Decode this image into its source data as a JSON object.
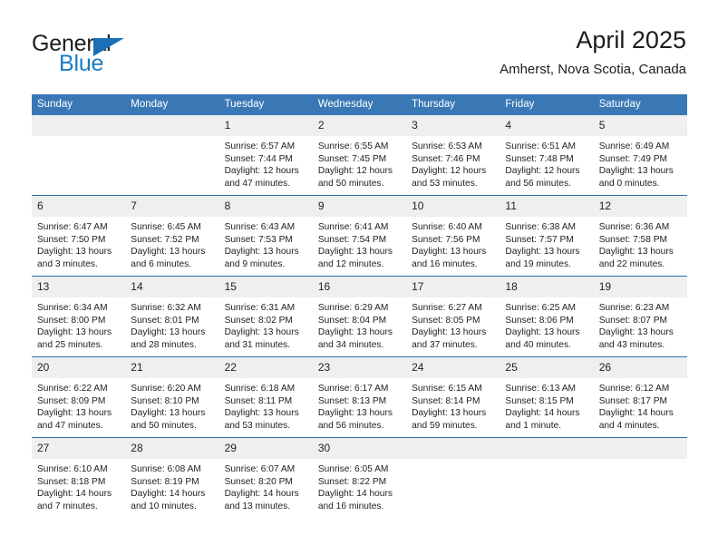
{
  "brand": {
    "name_part1": "General",
    "name_part2": "Blue",
    "triangle_color": "#1a6fb5",
    "blue_text_color": "#1a7bc4"
  },
  "header": {
    "title": "April 2025",
    "subtitle": "Amherst, Nova Scotia, Canada"
  },
  "theme": {
    "header_blue": "#3a78b5",
    "grid_line_blue": "#2e6da4",
    "daynum_band": "#efefef",
    "text": "#222222"
  },
  "calendar": {
    "weekday_headers": [
      "Sunday",
      "Monday",
      "Tuesday",
      "Wednesday",
      "Thursday",
      "Friday",
      "Saturday"
    ],
    "weeks": [
      [
        {
          "day": "",
          "sunrise": "",
          "sunset": "",
          "daylight_line1": "",
          "daylight_line2": "",
          "blank": true
        },
        {
          "day": "",
          "sunrise": "",
          "sunset": "",
          "daylight_line1": "",
          "daylight_line2": "",
          "blank": true
        },
        {
          "day": "1",
          "sunrise": "Sunrise: 6:57 AM",
          "sunset": "Sunset: 7:44 PM",
          "daylight_line1": "Daylight: 12 hours",
          "daylight_line2": "and 47 minutes."
        },
        {
          "day": "2",
          "sunrise": "Sunrise: 6:55 AM",
          "sunset": "Sunset: 7:45 PM",
          "daylight_line1": "Daylight: 12 hours",
          "daylight_line2": "and 50 minutes."
        },
        {
          "day": "3",
          "sunrise": "Sunrise: 6:53 AM",
          "sunset": "Sunset: 7:46 PM",
          "daylight_line1": "Daylight: 12 hours",
          "daylight_line2": "and 53 minutes."
        },
        {
          "day": "4",
          "sunrise": "Sunrise: 6:51 AM",
          "sunset": "Sunset: 7:48 PM",
          "daylight_line1": "Daylight: 12 hours",
          "daylight_line2": "and 56 minutes."
        },
        {
          "day": "5",
          "sunrise": "Sunrise: 6:49 AM",
          "sunset": "Sunset: 7:49 PM",
          "daylight_line1": "Daylight: 13 hours",
          "daylight_line2": "and 0 minutes."
        }
      ],
      [
        {
          "day": "6",
          "sunrise": "Sunrise: 6:47 AM",
          "sunset": "Sunset: 7:50 PM",
          "daylight_line1": "Daylight: 13 hours",
          "daylight_line2": "and 3 minutes."
        },
        {
          "day": "7",
          "sunrise": "Sunrise: 6:45 AM",
          "sunset": "Sunset: 7:52 PM",
          "daylight_line1": "Daylight: 13 hours",
          "daylight_line2": "and 6 minutes."
        },
        {
          "day": "8",
          "sunrise": "Sunrise: 6:43 AM",
          "sunset": "Sunset: 7:53 PM",
          "daylight_line1": "Daylight: 13 hours",
          "daylight_line2": "and 9 minutes."
        },
        {
          "day": "9",
          "sunrise": "Sunrise: 6:41 AM",
          "sunset": "Sunset: 7:54 PM",
          "daylight_line1": "Daylight: 13 hours",
          "daylight_line2": "and 12 minutes."
        },
        {
          "day": "10",
          "sunrise": "Sunrise: 6:40 AM",
          "sunset": "Sunset: 7:56 PM",
          "daylight_line1": "Daylight: 13 hours",
          "daylight_line2": "and 16 minutes."
        },
        {
          "day": "11",
          "sunrise": "Sunrise: 6:38 AM",
          "sunset": "Sunset: 7:57 PM",
          "daylight_line1": "Daylight: 13 hours",
          "daylight_line2": "and 19 minutes."
        },
        {
          "day": "12",
          "sunrise": "Sunrise: 6:36 AM",
          "sunset": "Sunset: 7:58 PM",
          "daylight_line1": "Daylight: 13 hours",
          "daylight_line2": "and 22 minutes."
        }
      ],
      [
        {
          "day": "13",
          "sunrise": "Sunrise: 6:34 AM",
          "sunset": "Sunset: 8:00 PM",
          "daylight_line1": "Daylight: 13 hours",
          "daylight_line2": "and 25 minutes."
        },
        {
          "day": "14",
          "sunrise": "Sunrise: 6:32 AM",
          "sunset": "Sunset: 8:01 PM",
          "daylight_line1": "Daylight: 13 hours",
          "daylight_line2": "and 28 minutes."
        },
        {
          "day": "15",
          "sunrise": "Sunrise: 6:31 AM",
          "sunset": "Sunset: 8:02 PM",
          "daylight_line1": "Daylight: 13 hours",
          "daylight_line2": "and 31 minutes."
        },
        {
          "day": "16",
          "sunrise": "Sunrise: 6:29 AM",
          "sunset": "Sunset: 8:04 PM",
          "daylight_line1": "Daylight: 13 hours",
          "daylight_line2": "and 34 minutes."
        },
        {
          "day": "17",
          "sunrise": "Sunrise: 6:27 AM",
          "sunset": "Sunset: 8:05 PM",
          "daylight_line1": "Daylight: 13 hours",
          "daylight_line2": "and 37 minutes."
        },
        {
          "day": "18",
          "sunrise": "Sunrise: 6:25 AM",
          "sunset": "Sunset: 8:06 PM",
          "daylight_line1": "Daylight: 13 hours",
          "daylight_line2": "and 40 minutes."
        },
        {
          "day": "19",
          "sunrise": "Sunrise: 6:23 AM",
          "sunset": "Sunset: 8:07 PM",
          "daylight_line1": "Daylight: 13 hours",
          "daylight_line2": "and 43 minutes."
        }
      ],
      [
        {
          "day": "20",
          "sunrise": "Sunrise: 6:22 AM",
          "sunset": "Sunset: 8:09 PM",
          "daylight_line1": "Daylight: 13 hours",
          "daylight_line2": "and 47 minutes."
        },
        {
          "day": "21",
          "sunrise": "Sunrise: 6:20 AM",
          "sunset": "Sunset: 8:10 PM",
          "daylight_line1": "Daylight: 13 hours",
          "daylight_line2": "and 50 minutes."
        },
        {
          "day": "22",
          "sunrise": "Sunrise: 6:18 AM",
          "sunset": "Sunset: 8:11 PM",
          "daylight_line1": "Daylight: 13 hours",
          "daylight_line2": "and 53 minutes."
        },
        {
          "day": "23",
          "sunrise": "Sunrise: 6:17 AM",
          "sunset": "Sunset: 8:13 PM",
          "daylight_line1": "Daylight: 13 hours",
          "daylight_line2": "and 56 minutes."
        },
        {
          "day": "24",
          "sunrise": "Sunrise: 6:15 AM",
          "sunset": "Sunset: 8:14 PM",
          "daylight_line1": "Daylight: 13 hours",
          "daylight_line2": "and 59 minutes."
        },
        {
          "day": "25",
          "sunrise": "Sunrise: 6:13 AM",
          "sunset": "Sunset: 8:15 PM",
          "daylight_line1": "Daylight: 14 hours",
          "daylight_line2": "and 1 minute."
        },
        {
          "day": "26",
          "sunrise": "Sunrise: 6:12 AM",
          "sunset": "Sunset: 8:17 PM",
          "daylight_line1": "Daylight: 14 hours",
          "daylight_line2": "and 4 minutes."
        }
      ],
      [
        {
          "day": "27",
          "sunrise": "Sunrise: 6:10 AM",
          "sunset": "Sunset: 8:18 PM",
          "daylight_line1": "Daylight: 14 hours",
          "daylight_line2": "and 7 minutes."
        },
        {
          "day": "28",
          "sunrise": "Sunrise: 6:08 AM",
          "sunset": "Sunset: 8:19 PM",
          "daylight_line1": "Daylight: 14 hours",
          "daylight_line2": "and 10 minutes."
        },
        {
          "day": "29",
          "sunrise": "Sunrise: 6:07 AM",
          "sunset": "Sunset: 8:20 PM",
          "daylight_line1": "Daylight: 14 hours",
          "daylight_line2": "and 13 minutes."
        },
        {
          "day": "30",
          "sunrise": "Sunrise: 6:05 AM",
          "sunset": "Sunset: 8:22 PM",
          "daylight_line1": "Daylight: 14 hours",
          "daylight_line2": "and 16 minutes."
        },
        {
          "day": "",
          "sunrise": "",
          "sunset": "",
          "daylight_line1": "",
          "daylight_line2": "",
          "blank": true
        },
        {
          "day": "",
          "sunrise": "",
          "sunset": "",
          "daylight_line1": "",
          "daylight_line2": "",
          "blank": true
        },
        {
          "day": "",
          "sunrise": "",
          "sunset": "",
          "daylight_line1": "",
          "daylight_line2": "",
          "blank": true
        }
      ]
    ]
  }
}
